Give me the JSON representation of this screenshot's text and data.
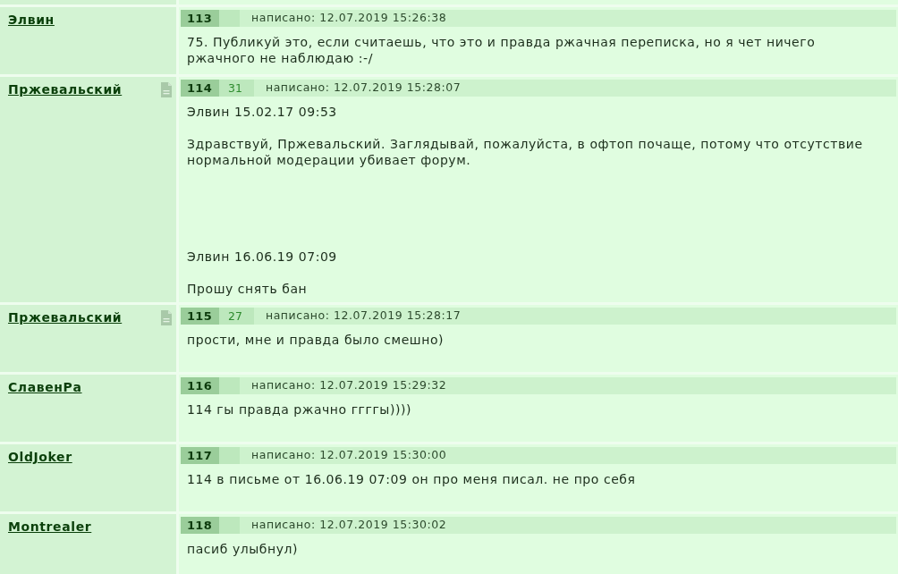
{
  "posts": [
    {
      "author": "Элвин",
      "doc_icon": false,
      "number": "113",
      "posted": "написано: 12.07.2019 15:26:38",
      "text": "75. Публикуй это, если считаешь, что это и правда ржачная переписка, но я чет ничего ржачного не наблюдаю :-/"
    },
    {
      "author": "Пржевальский",
      "doc_icon": true,
      "number": "114",
      "rating": "31",
      "posted": "написано: 12.07.2019 15:28:07",
      "text": "Элвин 15.02.17 09:53\n\nЗдравствуй, Пржевальский. Заглядывай, пожалуйста, в офтоп почаще, потому что отсутствие нормальной модерации убивает форум.\n\n\n\n\n\nЭлвин 16.06.19 07:09\n\nПрошу снять бан"
    },
    {
      "author": "Пржевальский",
      "doc_icon": true,
      "number": "115",
      "rating": "27",
      "posted": "написано: 12.07.2019 15:28:17",
      "text": "прости, мне и правда было смешно)"
    },
    {
      "author": "СлавенРа",
      "doc_icon": false,
      "number": "116",
      "posted": "написано: 12.07.2019 15:29:32",
      "text": "114 гы правда ржачно ггггы))))"
    },
    {
      "author": "OldJoker",
      "doc_icon": false,
      "number": "117",
      "posted": "написано: 12.07.2019 15:30:00",
      "text": "114 в письме от 16.06.19 07:09 он про меня писал. не про себя"
    },
    {
      "author": "Montrealer",
      "doc_icon": false,
      "number": "118",
      "posted": "написано: 12.07.2019 15:30:02",
      "text": "пасиб улыбнул)"
    }
  ]
}
